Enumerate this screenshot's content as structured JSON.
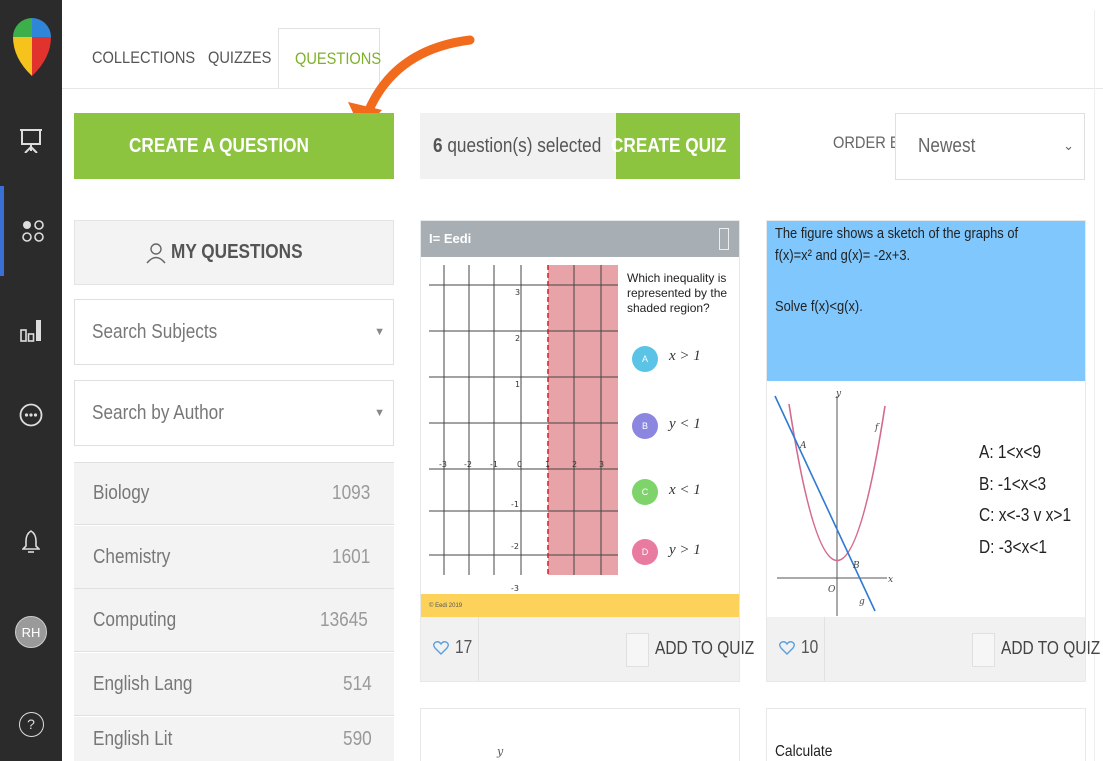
{
  "rail": {
    "items": [
      "logo",
      "presentation-icon",
      "apps-icon",
      "reports-icon",
      "more-icon",
      "bell-icon",
      "avatar",
      "help-icon"
    ],
    "avatar_initials": "RH",
    "help_label": "?"
  },
  "tabs": [
    "COLLECTIONS",
    "QUIZZES",
    "QUESTIONS"
  ],
  "active_tab": "QUESTIONS",
  "create_question_label": "CREATE A QUESTION",
  "my_questions_label": "MY QUESTIONS",
  "search_subjects_placeholder": "Search Subjects",
  "search_author_placeholder": "Search by Author",
  "subjects": [
    {
      "name": "Biology",
      "count": "1093"
    },
    {
      "name": "Chemistry",
      "count": "1601"
    },
    {
      "name": "Computing",
      "count": "13645"
    },
    {
      "name": "English Lang",
      "count": "514"
    },
    {
      "name": "English Lit",
      "count": "590"
    }
  ],
  "selection": {
    "count": "6",
    "text": "question(s) selected"
  },
  "create_quiz_label": "CREATE QUIZ",
  "order_by": {
    "label": "ORDER BY:",
    "value": "Newest"
  },
  "cards": [
    {
      "header": "I= Eedi",
      "question": "Which inequality is represented by the shaded region?",
      "options": [
        {
          "letter": "A",
          "text": "x > 1",
          "color": "#5bc3e6"
        },
        {
          "letter": "B",
          "text": "y < 1",
          "color": "#8b86e0"
        },
        {
          "letter": "C",
          "text": "x < 1",
          "color": "#7ed36a"
        },
        {
          "letter": "D",
          "text": "y > 1",
          "color": "#e97aa0"
        }
      ],
      "x_ticks": [
        "-3",
        "-2",
        "-1",
        "0",
        "1",
        "2",
        "3"
      ],
      "y_ticks": [
        "3",
        "2",
        "1",
        "-1",
        "-2",
        "-3"
      ],
      "footer_note": "© Eedi 2019",
      "likes": "17",
      "add_label": "ADD TO QUIZ"
    },
    {
      "header_lines": [
        "The figure shows a sketch of the graphs of",
        "f(x)=x² and g(x)= -2x+3.",
        "",
        "Solve f(x)<g(x)."
      ],
      "answers": [
        "A:  1<x<9",
        "B:  -1<x<3",
        "C:  x<-3 v x>1",
        "D:  -3<x<1"
      ],
      "graph_labels": {
        "y": "y",
        "x": "x",
        "o": "O",
        "a": "A",
        "b": "B",
        "f": "f",
        "g": "g"
      },
      "likes": "10",
      "add_label": "ADD TO QUIZ"
    }
  ],
  "partial_cards": [
    {
      "text": "y"
    },
    {
      "text": "Calculate"
    }
  ],
  "colors": {
    "accent_green": "#8cc43f",
    "rail": "#2b2b2b",
    "card2_header": "#7fc7fd",
    "shade": "#e8a3a8",
    "yellow": "#fcd25b",
    "arrow": "#f26a1b"
  }
}
